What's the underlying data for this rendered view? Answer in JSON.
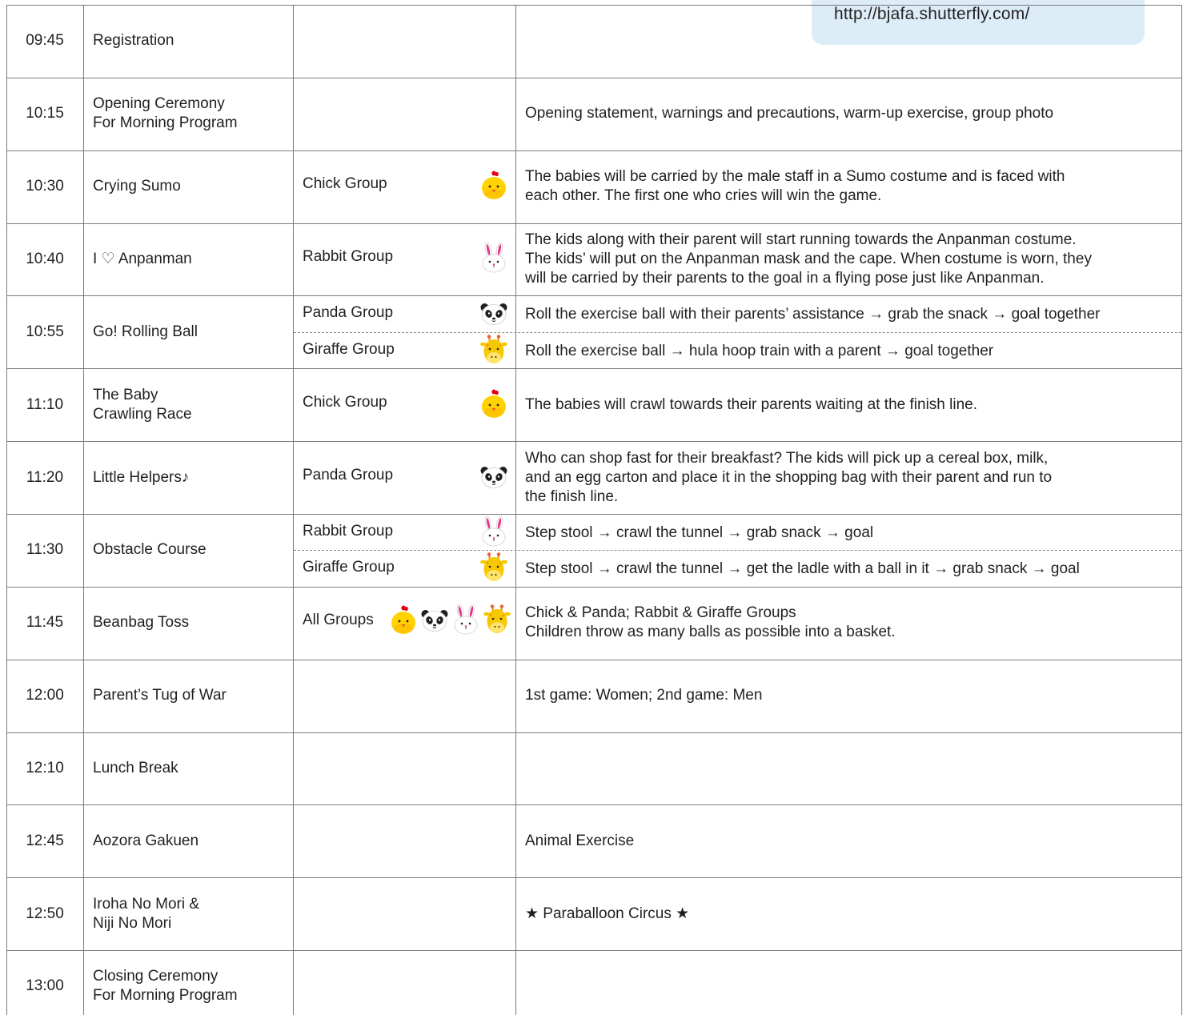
{
  "url_box": {
    "text": "http://bjafa.shutterfly.com/"
  },
  "schedule": {
    "rows": [
      {
        "time": "09:45",
        "event": [
          "Registration"
        ],
        "groups": [],
        "details": []
      },
      {
        "time": "10:15",
        "event": [
          "Opening Ceremony",
          "For Morning Program"
        ],
        "groups": [],
        "details": [
          "Opening statement, warnings and precautions, warm-up exercise, group photo"
        ]
      },
      {
        "time": "10:30",
        "event": [
          "Crying Sumo"
        ],
        "groups": [
          {
            "label": "Chick Group",
            "icons": [
              "chick-icon"
            ]
          }
        ],
        "details": [
          "The babies will be carried by the male staff in a Sumo costume and is faced with",
          "each other. The first one who cries will win the game."
        ]
      },
      {
        "time": "10:40",
        "event": [
          "I ♡ Anpanman"
        ],
        "groups": [
          {
            "label": "Rabbit Group",
            "icons": [
              "rabbit-icon"
            ]
          }
        ],
        "details": [
          "The kids along with their parent will start running towards the Anpanman costume.",
          "The kids’ will put on the Anpanman mask and the cape. When costume is worn, they",
          "will be carried by their parents to the goal in a flying pose just like Anpanman."
        ]
      },
      {
        "time": "10:55",
        "event": [
          "Go! Rolling Ball"
        ],
        "groups": [
          {
            "label": "Panda Group",
            "icons": [
              "panda-icon"
            ]
          },
          {
            "label": "Giraffe Group",
            "icons": [
              "giraffe-icon"
            ]
          }
        ],
        "details": [
          "Roll the exercise ball with their parents’ assistance → grab the snack → goal together",
          "Roll the exercise ball → hula hoop train with a parent → goal together"
        ]
      },
      {
        "time": "11:10",
        "event": [
          "The Baby",
          "Crawling Race"
        ],
        "groups": [
          {
            "label": "Chick Group",
            "icons": [
              "chick-icon"
            ]
          }
        ],
        "details": [
          "The babies will crawl towards their parents waiting at the finish line."
        ]
      },
      {
        "time": "11:20",
        "event": [
          "Little Helpers♪"
        ],
        "groups": [
          {
            "label": "Panda Group",
            "icons": [
              "panda-icon"
            ]
          }
        ],
        "details": [
          "Who can shop fast for their breakfast? The kids will pick up a cereal box, milk,",
          "and an egg carton and place it in the shopping bag with their parent and run to",
          "the finish line."
        ]
      },
      {
        "time": "11:30",
        "event": [
          "Obstacle Course"
        ],
        "groups": [
          {
            "label": "Rabbit Group",
            "icons": [
              "rabbit-icon"
            ]
          },
          {
            "label": "Giraffe Group",
            "icons": [
              "giraffe-icon"
            ]
          }
        ],
        "details": [
          "Step stool → crawl the tunnel → grab snack → goal",
          "Step stool → crawl the tunnel → get the ladle with a ball in it → grab snack → goal"
        ]
      },
      {
        "time": "11:45",
        "event": [
          "Beanbag Toss"
        ],
        "groups": [
          {
            "label": "All Groups",
            "icons": [
              "chick-icon",
              "panda-icon",
              "rabbit-icon",
              "giraffe-icon"
            ]
          }
        ],
        "details": [
          "Chick & Panda; Rabbit & Giraffe Groups",
          "Children throw as many balls as possible into a basket."
        ]
      },
      {
        "time": "12:00",
        "event": [
          "Parent’s Tug of War"
        ],
        "groups": [],
        "details": [
          "1st game: Women; 2nd game: Men"
        ]
      },
      {
        "time": "12:10",
        "event": [
          "Lunch Break"
        ],
        "groups": [],
        "details": []
      },
      {
        "time": "12:45",
        "event": [
          "Aozora Gakuen"
        ],
        "groups": [],
        "details": [
          "Animal Exercise"
        ]
      },
      {
        "time": "12:50",
        "event": [
          "Iroha No Mori &",
          "Niji No Mori"
        ],
        "groups": [],
        "details": [
          "★ Paraballoon Circus ★"
        ]
      },
      {
        "time": "13:00",
        "event": [
          "Closing Ceremony",
          "For Morning Program"
        ],
        "groups": [],
        "details": []
      }
    ]
  },
  "icon_colors": {
    "chick": "#ffd200",
    "rabbit_ears": "#e6378a",
    "giraffe": "#f7c800"
  }
}
